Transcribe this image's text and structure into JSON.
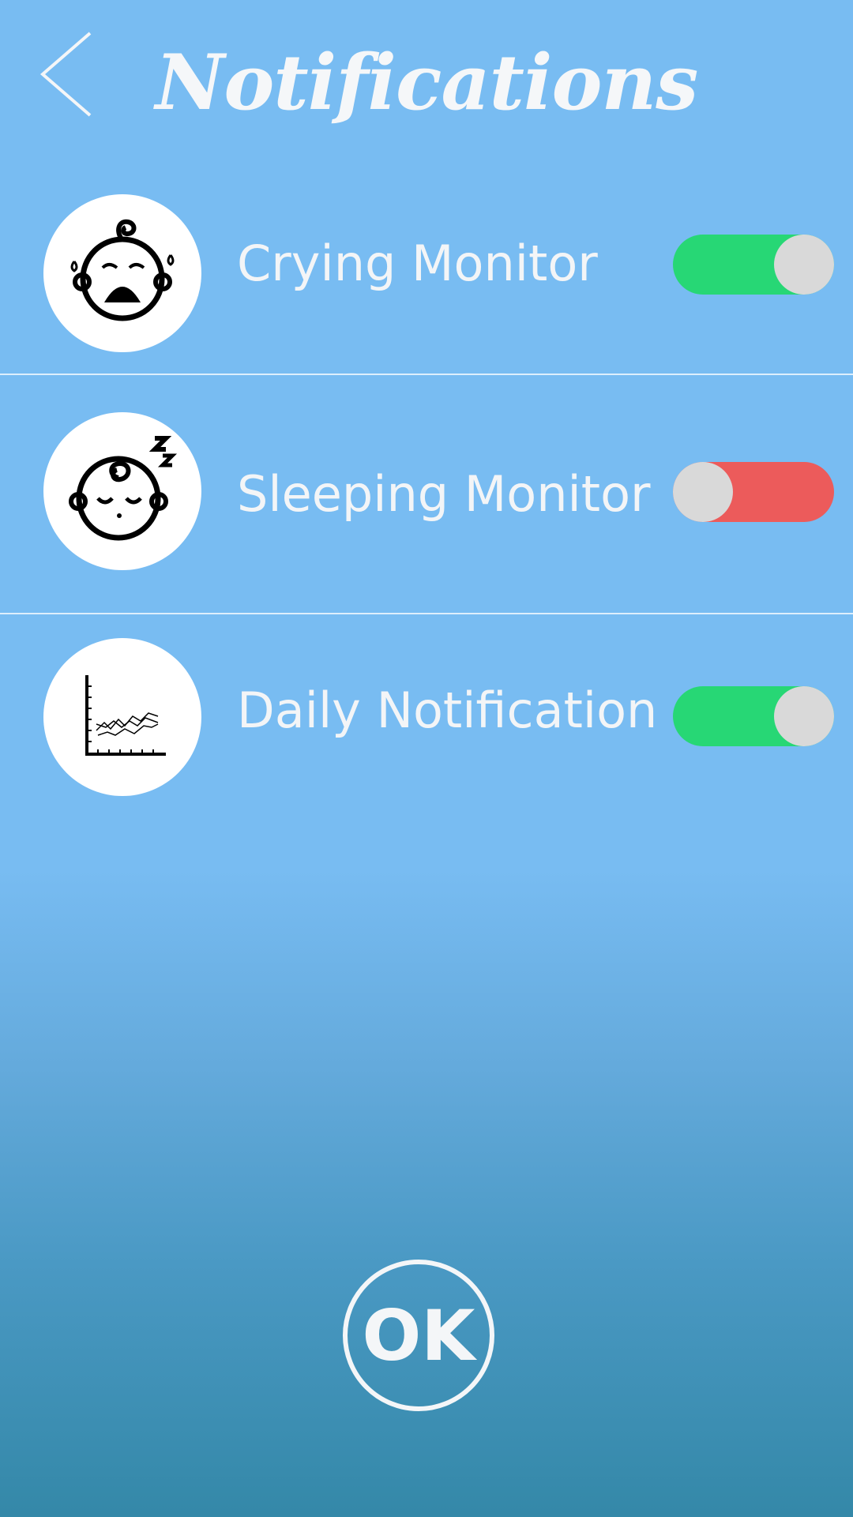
{
  "header": {
    "title": "Notifications",
    "back_icon": "chevron-left-icon"
  },
  "settings": [
    {
      "label": "Crying Monitor",
      "icon": "crying-baby-icon",
      "enabled": true
    },
    {
      "label": "Sleeping Monitor",
      "icon": "sleeping-baby-icon",
      "enabled": false
    },
    {
      "label": "Daily Notification",
      "icon": "line-chart-icon",
      "enabled": true
    }
  ],
  "footer": {
    "ok_label": "OK"
  },
  "colors": {
    "background_top": "#78bcf2",
    "background_bottom": "#3488a8",
    "toggle_on": "#27d775",
    "toggle_off": "#ec5b5b",
    "toggle_knob": "#d9d9d9"
  }
}
